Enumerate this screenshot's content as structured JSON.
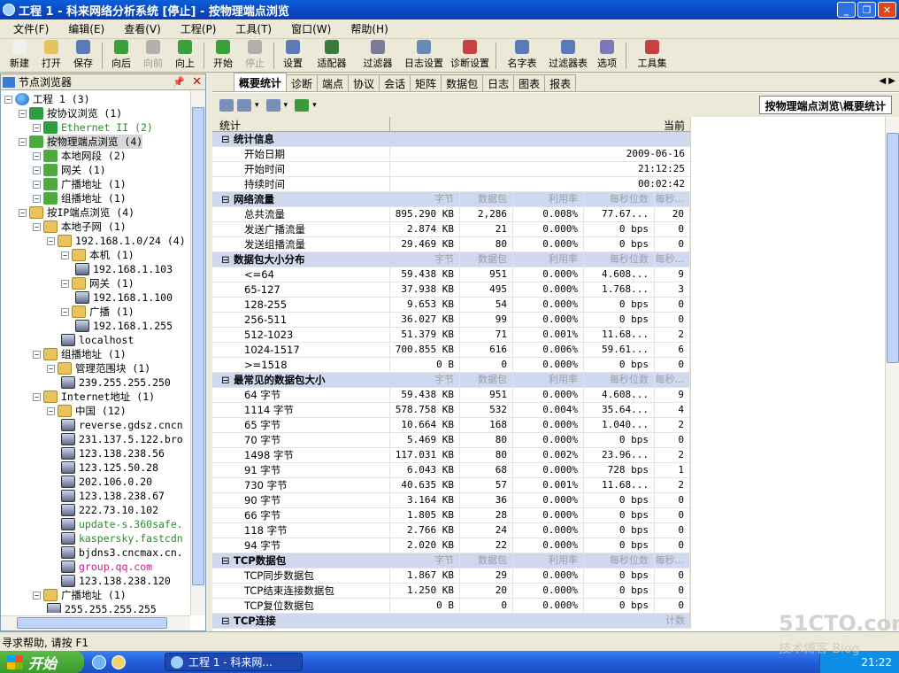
{
  "window": {
    "title": "工程 1 - 科来网络分析系统 [停止] - 按物理端点浏览"
  },
  "menu": [
    "文件(F)",
    "编辑(E)",
    "查看(V)",
    "工程(P)",
    "工具(T)",
    "窗口(W)",
    "帮助(H)"
  ],
  "toolbar": [
    {
      "label": "新建",
      "icon": "new-icon",
      "disabled": false
    },
    {
      "label": "打开",
      "icon": "open-icon",
      "disabled": false
    },
    {
      "label": "保存",
      "icon": "save-icon",
      "disabled": false
    },
    {
      "label": "向后",
      "icon": "back-icon",
      "disabled": false
    },
    {
      "label": "向前",
      "icon": "forward-icon",
      "disabled": true
    },
    {
      "label": "向上",
      "icon": "up-icon",
      "disabled": false
    },
    {
      "label": "开始",
      "icon": "start-icon",
      "disabled": false
    },
    {
      "label": "停止",
      "icon": "stop-icon",
      "disabled": true
    },
    {
      "label": "设置",
      "icon": "settings-icon",
      "disabled": false
    },
    {
      "label": "适配器",
      "icon": "adapter-icon",
      "disabled": false
    },
    {
      "label": "过滤器",
      "icon": "filter-icon",
      "disabled": false
    },
    {
      "label": "日志设置",
      "icon": "log-settings-icon",
      "disabled": false
    },
    {
      "label": "诊断设置",
      "icon": "diagnosis-settings-icon",
      "disabled": false
    },
    {
      "label": "名字表",
      "icon": "name-table-icon",
      "disabled": false
    },
    {
      "label": "过滤器表",
      "icon": "filter-table-icon",
      "disabled": false
    },
    {
      "label": "选项",
      "icon": "options-icon",
      "disabled": false
    },
    {
      "label": "工具集",
      "icon": "toolset-icon",
      "disabled": false
    }
  ],
  "left_panel": {
    "title": "节点浏览器",
    "tree": [
      {
        "label": "工程 1 (3)",
        "level": 0,
        "icon": "globe",
        "color": "#000000"
      },
      {
        "label": "按协议浏览 (1)",
        "level": 1,
        "icon": "filter",
        "color": "#000000"
      },
      {
        "label": "Ethernet II (2)",
        "level": 2,
        "icon": "filter",
        "color": "#2e8b2e"
      },
      {
        "label": "按物理端点浏览 (4)",
        "level": 1,
        "icon": "green",
        "color": "#000000",
        "selected": true
      },
      {
        "label": "本地网段 (2)",
        "level": 2,
        "icon": "green",
        "color": "#000000"
      },
      {
        "label": "网关 (1)",
        "level": 2,
        "icon": "green",
        "color": "#000000"
      },
      {
        "label": "广播地址 (1)",
        "level": 2,
        "icon": "green",
        "color": "#000000"
      },
      {
        "label": "组播地址 (1)",
        "level": 2,
        "icon": "green",
        "color": "#000000"
      },
      {
        "label": "按IP端点浏览 (4)",
        "level": 1,
        "icon": "folder",
        "color": "#000000"
      },
      {
        "label": "本地子网 (1)",
        "level": 2,
        "icon": "folder",
        "color": "#000000"
      },
      {
        "label": "192.168.1.0/24 (4)",
        "level": 3,
        "icon": "folder",
        "color": "#000000"
      },
      {
        "label": "本机 (1)",
        "level": 4,
        "icon": "folder",
        "color": "#000000"
      },
      {
        "label": "192.168.1.103",
        "level": 5,
        "icon": "pc",
        "color": "#000000"
      },
      {
        "label": "网关 (1)",
        "level": 4,
        "icon": "folder",
        "color": "#000000"
      },
      {
        "label": "192.168.1.100",
        "level": 5,
        "icon": "pc",
        "color": "#000000"
      },
      {
        "label": "广播 (1)",
        "level": 4,
        "icon": "folder",
        "color": "#000000"
      },
      {
        "label": "192.168.1.255",
        "level": 5,
        "icon": "pc",
        "color": "#000000"
      },
      {
        "label": "localhost",
        "level": 4,
        "icon": "pc",
        "color": "#000000"
      },
      {
        "label": "组播地址 (1)",
        "level": 2,
        "icon": "folder",
        "color": "#000000"
      },
      {
        "label": "管理范围块 (1)",
        "level": 3,
        "icon": "folder",
        "color": "#000000"
      },
      {
        "label": "239.255.255.250",
        "level": 4,
        "icon": "pc",
        "color": "#000000"
      },
      {
        "label": "Internet地址 (1)",
        "level": 2,
        "icon": "folder",
        "color": "#000000"
      },
      {
        "label": "中国 (12)",
        "level": 3,
        "icon": "folder",
        "color": "#000000"
      },
      {
        "label": "reverse.gdsz.cncn",
        "level": 4,
        "icon": "pc",
        "color": "#000000"
      },
      {
        "label": "231.137.5.122.bro",
        "level": 4,
        "icon": "pc",
        "color": "#000000"
      },
      {
        "label": "123.138.238.56",
        "level": 4,
        "icon": "pc",
        "color": "#000000"
      },
      {
        "label": "123.125.50.28",
        "level": 4,
        "icon": "pc",
        "color": "#000000"
      },
      {
        "label": "202.106.0.20",
        "level": 4,
        "icon": "pc",
        "color": "#000000"
      },
      {
        "label": "123.138.238.67",
        "level": 4,
        "icon": "pc",
        "color": "#000000"
      },
      {
        "label": "222.73.10.102",
        "level": 4,
        "icon": "pc",
        "color": "#000000"
      },
      {
        "label": "update-s.360safe.",
        "level": 4,
        "icon": "pc",
        "color": "#2e8b2e"
      },
      {
        "label": "kaspersky.fastcdn",
        "level": 4,
        "icon": "pc",
        "color": "#2e8b2e"
      },
      {
        "label": "bjdns3.cncmax.cn.",
        "level": 4,
        "icon": "pc",
        "color": "#000000"
      },
      {
        "label": "group.qq.com",
        "level": 4,
        "icon": "pc",
        "color": "#c0208a"
      },
      {
        "label": "123.138.238.120",
        "level": 4,
        "icon": "pc",
        "color": "#000000"
      },
      {
        "label": "广播地址 (1)",
        "level": 2,
        "icon": "folder",
        "color": "#000000"
      },
      {
        "label": "255.255.255.255",
        "level": 3,
        "icon": "pc",
        "color": "#000000"
      }
    ]
  },
  "tabs": [
    "概要统计",
    "诊断",
    "端点",
    "协议",
    "会话",
    "矩阵",
    "数据包",
    "日志",
    "图表",
    "报表"
  ],
  "active_tab": "概要统计",
  "breadcrumb": "按物理端点浏览\\概要统计",
  "grid": {
    "header": {
      "name": "统计",
      "value": "当前"
    },
    "sub_columns": [
      "字节",
      "数据包",
      "利用率",
      "每秒位数",
      "每秒..."
    ],
    "rows": [
      {
        "kind": "section",
        "name": "统计信息"
      },
      {
        "kind": "info",
        "name": "开始日期",
        "value": "2009-06-16"
      },
      {
        "kind": "info",
        "name": "开始时间",
        "value": "21:12:25"
      },
      {
        "kind": "info",
        "name": "持续时间",
        "value": "00:02:42"
      },
      {
        "kind": "section",
        "name": "网络流量",
        "subhead": true
      },
      {
        "kind": "data",
        "name": "总共流量",
        "bytes": "895.290 KB",
        "packets": "2,286",
        "util": "0.008%",
        "bps": "77.67...",
        "pps": "20"
      },
      {
        "kind": "data",
        "name": "发送广播流量",
        "bytes": "2.874 KB",
        "packets": "21",
        "util": "0.000%",
        "bps": "0 bps",
        "pps": "0"
      },
      {
        "kind": "data",
        "name": "发送组播流量",
        "bytes": "29.469 KB",
        "packets": "80",
        "util": "0.000%",
        "bps": "0 bps",
        "pps": "0"
      },
      {
        "kind": "section",
        "name": "数据包大小分布",
        "subhead": true
      },
      {
        "kind": "data",
        "name": "<=64",
        "bytes": "59.438 KB",
        "packets": "951",
        "util": "0.000%",
        "bps": "4.608...",
        "pps": "9"
      },
      {
        "kind": "data",
        "name": "65-127",
        "bytes": "37.938 KB",
        "packets": "495",
        "util": "0.000%",
        "bps": "1.768...",
        "pps": "3"
      },
      {
        "kind": "data",
        "name": "128-255",
        "bytes": "9.653 KB",
        "packets": "54",
        "util": "0.000%",
        "bps": "0 bps",
        "pps": "0"
      },
      {
        "kind": "data",
        "name": "256-511",
        "bytes": "36.027 KB",
        "packets": "99",
        "util": "0.000%",
        "bps": "0 bps",
        "pps": "0"
      },
      {
        "kind": "data",
        "name": "512-1023",
        "bytes": "51.379 KB",
        "packets": "71",
        "util": "0.001%",
        "bps": "11.68...",
        "pps": "2"
      },
      {
        "kind": "data",
        "name": "1024-1517",
        "bytes": "700.855 KB",
        "packets": "616",
        "util": "0.006%",
        "bps": "59.61...",
        "pps": "6"
      },
      {
        "kind": "data",
        "name": ">=1518",
        "bytes": "0 B",
        "packets": "0",
        "util": "0.000%",
        "bps": "0 bps",
        "pps": "0"
      },
      {
        "kind": "section",
        "name": "最常见的数据包大小",
        "subhead": true
      },
      {
        "kind": "data",
        "name": "64 字节",
        "bytes": "59.438 KB",
        "packets": "951",
        "util": "0.000%",
        "bps": "4.608...",
        "pps": "9"
      },
      {
        "kind": "data",
        "name": "1114 字节",
        "bytes": "578.758 KB",
        "packets": "532",
        "util": "0.004%",
        "bps": "35.64...",
        "pps": "4"
      },
      {
        "kind": "data",
        "name": "65 字节",
        "bytes": "10.664 KB",
        "packets": "168",
        "util": "0.000%",
        "bps": "1.040...",
        "pps": "2"
      },
      {
        "kind": "data",
        "name": "70 字节",
        "bytes": "5.469 KB",
        "packets": "80",
        "util": "0.000%",
        "bps": "0 bps",
        "pps": "0"
      },
      {
        "kind": "data",
        "name": "1498 字节",
        "bytes": "117.031 KB",
        "packets": "80",
        "util": "0.002%",
        "bps": "23.96...",
        "pps": "2"
      },
      {
        "kind": "data",
        "name": "91 字节",
        "bytes": "6.043 KB",
        "packets": "68",
        "util": "0.000%",
        "bps": "728 bps",
        "pps": "1"
      },
      {
        "kind": "data",
        "name": "730 字节",
        "bytes": "40.635 KB",
        "packets": "57",
        "util": "0.001%",
        "bps": "11.68...",
        "pps": "2"
      },
      {
        "kind": "data",
        "name": "90 字节",
        "bytes": "3.164 KB",
        "packets": "36",
        "util": "0.000%",
        "bps": "0 bps",
        "pps": "0"
      },
      {
        "kind": "data",
        "name": "66 字节",
        "bytes": "1.805 KB",
        "packets": "28",
        "util": "0.000%",
        "bps": "0 bps",
        "pps": "0"
      },
      {
        "kind": "data",
        "name": "118 字节",
        "bytes": "2.766 KB",
        "packets": "24",
        "util": "0.000%",
        "bps": "0 bps",
        "pps": "0"
      },
      {
        "kind": "data",
        "name": "94 字节",
        "bytes": "2.020 KB",
        "packets": "22",
        "util": "0.000%",
        "bps": "0 bps",
        "pps": "0"
      },
      {
        "kind": "section",
        "name": "TCP数据包",
        "subhead": true
      },
      {
        "kind": "data",
        "name": "TCP同步数据包",
        "bytes": "1.867 KB",
        "packets": "29",
        "util": "0.000%",
        "bps": "0 bps",
        "pps": "0"
      },
      {
        "kind": "data",
        "name": "TCP结束连接数据包",
        "bytes": "1.250 KB",
        "packets": "20",
        "util": "0.000%",
        "bps": "0 bps",
        "pps": "0"
      },
      {
        "kind": "data",
        "name": "TCP复位数据包",
        "bytes": "0 B",
        "packets": "0",
        "util": "0.000%",
        "bps": "0 bps",
        "pps": "0"
      },
      {
        "kind": "section",
        "name": "TCP连接",
        "count_label": "计数"
      }
    ]
  },
  "statusbar": {
    "text": "寻求帮助, 请按 F1"
  },
  "taskbar": {
    "start": "开始",
    "task": "工程 1 - 科来网...",
    "clock": "21:22"
  },
  "watermark": {
    "line1": "51CTO.com",
    "line2": "技术博客 Blog"
  }
}
